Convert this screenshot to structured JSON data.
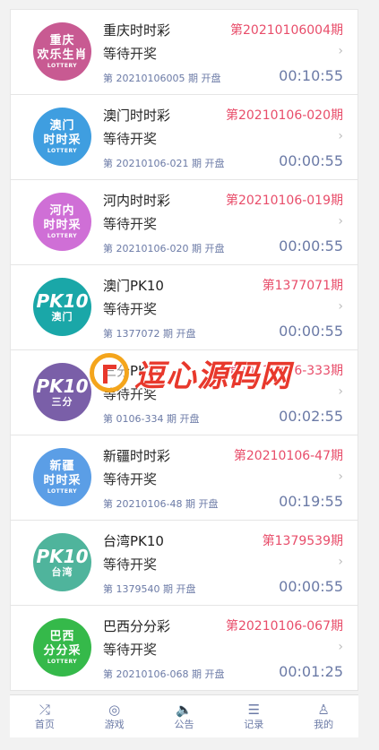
{
  "lotteries": [
    {
      "logo_l1": "重庆",
      "logo_l2": "欢乐生肖",
      "logo_l3": "LOTTERY",
      "logo_color": "#c85a92",
      "name": "重庆时时彩",
      "issue": "第20210106004期",
      "status": "等待开奖",
      "next": "第 20210106005 期 开盘",
      "timer": "00:10:55"
    },
    {
      "logo_l1": "澳门",
      "logo_l2": "时时采",
      "logo_l3": "LOTTERY",
      "logo_color": "#3f9ee0",
      "name": "澳门时时彩",
      "issue": "第20210106-020期",
      "status": "等待开奖",
      "next": "第 20210106-021 期 开盘",
      "timer": "00:00:55"
    },
    {
      "logo_l1": "河内",
      "logo_l2": "时时采",
      "logo_l3": "LOTTERY",
      "logo_color": "#cf6fd6",
      "name": "河内时时彩",
      "issue": "第20210106-019期",
      "status": "等待开奖",
      "next": "第 20210106-020 期 开盘",
      "timer": "00:00:55"
    },
    {
      "logo_l1": "PK10",
      "logo_l2": "澳门",
      "logo_l3": "",
      "logo_color": "#1aa7a8",
      "name": "澳门PK10",
      "issue": "第1377071期",
      "status": "等待开奖",
      "next": "第 1377072 期 开盘",
      "timer": "00:00:55",
      "pk": true
    },
    {
      "logo_l1": "PK10",
      "logo_l2": "三分",
      "logo_l3": "",
      "logo_color": "#7a5fa8",
      "name": "三分PK10",
      "issue": "第20210106-333期",
      "status": "等待开奖",
      "next": "第 0106-334 期 开盘",
      "timer": "00:02:55",
      "pk": true
    },
    {
      "logo_l1": "新疆",
      "logo_l2": "时时采",
      "logo_l3": "LOTTERY",
      "logo_color": "#5b9ee6",
      "name": "新疆时时彩",
      "issue": "第20210106-47期",
      "status": "等待开奖",
      "next": "第 20210106-48 期 开盘",
      "timer": "00:19:55"
    },
    {
      "logo_l1": "PK10",
      "logo_l2": "台湾",
      "logo_l3": "",
      "logo_color": "#4fb49c",
      "name": "台湾PK10",
      "issue": "第1379539期",
      "status": "等待开奖",
      "next": "第 1379540 期 开盘",
      "timer": "00:00:55",
      "pk": true
    },
    {
      "logo_l1": "巴西",
      "logo_l2": "分分采",
      "logo_l3": "LOTTERY",
      "logo_color": "#35b94a",
      "name": "巴西分分彩",
      "issue": "第20210106-067期",
      "status": "等待开奖",
      "next": "第 20210106-068 期 开盘",
      "timer": "00:01:25"
    }
  ],
  "chevron": "›",
  "watermark": {
    "text": "逗心源码网"
  },
  "tabbar": [
    {
      "icon": "shuffle-icon",
      "glyph": "⤮",
      "label": "首页"
    },
    {
      "icon": "game-icon",
      "glyph": "◎",
      "label": "游戏"
    },
    {
      "icon": "speaker-icon",
      "glyph": "🔈",
      "label": "公告"
    },
    {
      "icon": "list-icon",
      "glyph": "☰",
      "label": "记录"
    },
    {
      "icon": "user-icon",
      "glyph": "♙",
      "label": "我的"
    }
  ]
}
